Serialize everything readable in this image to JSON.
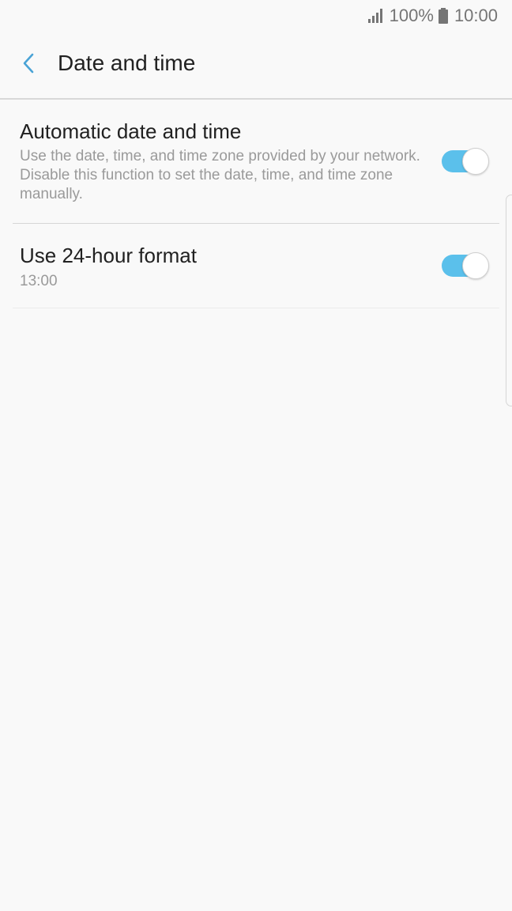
{
  "status_bar": {
    "battery_percent": "100%",
    "time": "10:00",
    "icons": [
      "signal-icon",
      "battery-icon"
    ]
  },
  "header": {
    "title": "Date and time",
    "back_icon": "chevron-left-icon"
  },
  "settings": [
    {
      "title": "Automatic date and time",
      "description": "Use the date, time, and time zone provided by your network. Disable this function to set the date, time, and time zone manually.",
      "enabled": true
    },
    {
      "title": "Use 24-hour format",
      "description": "13:00",
      "enabled": true
    }
  ],
  "colors": {
    "accent": "#5bc0eb",
    "background": "#f9f9f9",
    "title_text": "#212121",
    "secondary_text": "#9a9a9a"
  }
}
